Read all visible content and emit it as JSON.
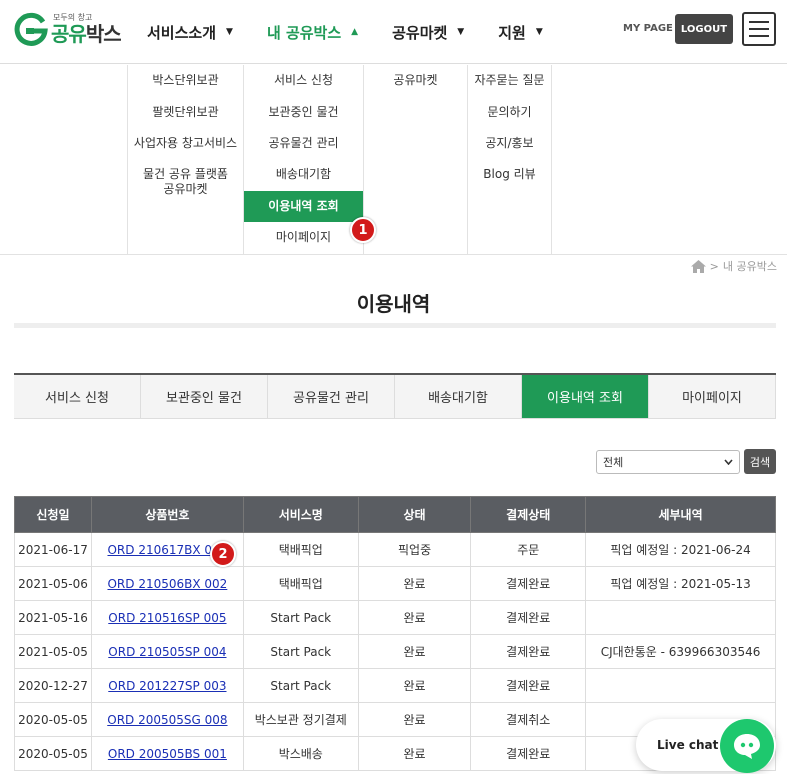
{
  "header": {
    "logo_small": "모두의 창고",
    "logo_main_green": "공유",
    "logo_main_dark": "박스",
    "nav": [
      {
        "label": "서비스소개",
        "caret": "▼",
        "active": false
      },
      {
        "label": "내 공유박스",
        "caret": "▲",
        "active": true
      },
      {
        "label": "공유마켓",
        "caret": "▼",
        "active": false
      },
      {
        "label": "지원",
        "caret": "▼",
        "active": false
      }
    ],
    "mypage": "MY PAGE",
    "logout": "LOGOUT"
  },
  "mega_menu": {
    "col1": [
      "박스단위보관",
      "팔렛단위보관",
      "사업자용 창고서비스",
      "물건 공유 플랫폼\n공유마켓"
    ],
    "col2": [
      "서비스 신청",
      "보관중인 물건",
      "공유물건 관리",
      "배송대기함",
      "이용내역 조회",
      "마이페이지"
    ],
    "col3": [
      "공유마켓"
    ],
    "col4": [
      "자주묻는 질문",
      "문의하기",
      "공지/홍보",
      "Blog 리뷰"
    ]
  },
  "badges": {
    "one": "1",
    "two": "2"
  },
  "breadcrumb": {
    "sep": ">",
    "current": "내 공유박스"
  },
  "page_title": "이용내역",
  "tabs": [
    "서비스 신청",
    "보관중인 물건",
    "공유물건 관리",
    "배송대기함",
    "이용내역 조회",
    "마이페이지"
  ],
  "filter": {
    "selected": "전체",
    "search": "검색"
  },
  "table": {
    "headers": [
      "신청일",
      "상품번호",
      "서비스명",
      "상태",
      "결제상태",
      "세부내역"
    ],
    "rows": [
      [
        "2021-06-17",
        "ORD 210617BX 001",
        "택배픽업",
        "픽업중",
        "주문",
        "픽업 예정일 : 2021-06-24"
      ],
      [
        "2021-05-06",
        "ORD 210506BX 002",
        "택배픽업",
        "완료",
        "결제완료",
        "픽업 예정일 : 2021-05-13"
      ],
      [
        "2021-05-16",
        "ORD 210516SP 005",
        "Start Pack",
        "완료",
        "결제완료",
        ""
      ],
      [
        "2021-05-05",
        "ORD 210505SP 004",
        "Start Pack",
        "완료",
        "결제완료",
        "CJ대한통운 - 639966303546"
      ],
      [
        "2020-12-27",
        "ORD 201227SP 003",
        "Start Pack",
        "완료",
        "결제완료",
        ""
      ],
      [
        "2020-05-05",
        "ORD 200505SG 008",
        "박스보관 정기결제",
        "완료",
        "결제취소",
        ""
      ],
      [
        "2020-05-05",
        "ORD 200505BS 001",
        "박스배송",
        "완료",
        "결제완료",
        ""
      ]
    ]
  },
  "livechat": "Live chat",
  "colors": {
    "brand_green": "#1f9a56",
    "badge_red": "#d21a1a",
    "chat_green": "#1ec86e"
  }
}
